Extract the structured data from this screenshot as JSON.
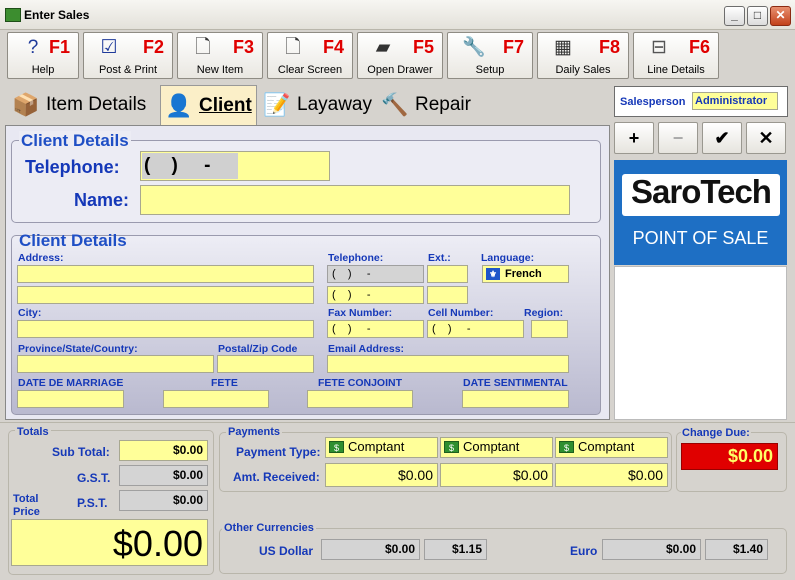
{
  "window": {
    "title": "Enter Sales"
  },
  "toolbar": [
    {
      "key": "F1",
      "label": "Help",
      "icon": "help-icon"
    },
    {
      "key": "F2",
      "label": "Post & Print",
      "icon": "post-print-icon"
    },
    {
      "key": "F3",
      "label": "New Item",
      "icon": "new-item-icon"
    },
    {
      "key": "F4",
      "label": "Clear Screen",
      "icon": "clear-screen-icon"
    },
    {
      "key": "F5",
      "label": "Open Drawer",
      "icon": "open-drawer-icon"
    },
    {
      "key": "F7",
      "label": "Setup",
      "icon": "setup-icon"
    },
    {
      "key": "F8",
      "label": "Daily Sales",
      "icon": "daily-sales-icon"
    },
    {
      "key": "F6",
      "label": "Line Details",
      "icon": "line-details-icon"
    }
  ],
  "tabs": [
    {
      "label": "Item Details"
    },
    {
      "label": "Client"
    },
    {
      "label": "Layaway"
    },
    {
      "label": "Repair"
    }
  ],
  "client_top": {
    "title": "Client Details",
    "telephone_label": "Telephone:",
    "telephone_value": "(    )     -",
    "name_label": "Name:"
  },
  "client_details": {
    "title": "Client Details",
    "address_label": "Address:",
    "city_label": "City:",
    "province_label": "Province/State/Country:",
    "postal_label": "Postal/Zip Code",
    "telephone_label": "Telephone:",
    "ext_label": "Ext.:",
    "language_label": "Language:",
    "language_value": "French",
    "phone_mask": "(    )     -",
    "fax_label": "Fax Number:",
    "cell_label": "Cell Number:",
    "region_label": "Region:",
    "email_label": "Email Address:",
    "date_marriage_label": "DATE DE MARRIAGE",
    "fete_label": "FETE",
    "fete_conjoint_label": "FETE CONJOINT",
    "date_sentimental_label": "DATE SENTIMENTAL"
  },
  "salesperson": {
    "label": "Salesperson",
    "value": "Administrator"
  },
  "action_buttons": {
    "add": "+",
    "remove": "−",
    "ok": "✔",
    "cancel": "✕"
  },
  "logo": {
    "brand": "SaroTech",
    "tagline": "POINT OF SALE"
  },
  "totals": {
    "title": "Totals",
    "subtotal_label": "Sub Total:",
    "subtotal_value": "$0.00",
    "gst_label": "G.S.T.",
    "gst_value": "$0.00",
    "pst_label": "P.S.T.",
    "pst_value": "$0.00",
    "total_label": "Total Price",
    "total_value": "$0.00"
  },
  "payments": {
    "title": "Payments",
    "type_label": "Payment Type:",
    "received_label": "Amt. Received:",
    "types": [
      "Comptant",
      "Comptant",
      "Comptant"
    ],
    "amounts": [
      "$0.00",
      "$0.00",
      "$0.00"
    ]
  },
  "change_due": {
    "label": "Change Due:",
    "value": "$0.00"
  },
  "currencies": {
    "title": "Other Currencies",
    "usd_label": "US Dollar",
    "usd_amount": "$0.00",
    "usd_rate": "$1.15",
    "eur_label": "Euro",
    "eur_amount": "$0.00",
    "eur_rate": "$1.40"
  },
  "colors": {
    "field_yellow": "#ffff99",
    "label_blue": "#1538b8",
    "change_red": "#e00000",
    "brand_blue": "#1e6fc4"
  }
}
